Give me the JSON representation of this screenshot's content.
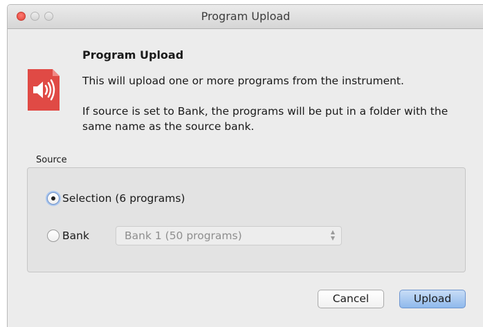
{
  "window": {
    "title": "Program Upload"
  },
  "dialog": {
    "heading": "Program Upload",
    "description": "This will upload one or more programs from the instrument.",
    "note": "If source is set to Bank, the programs will be put in a folder with the same name as the source bank.",
    "icon": "speaker-document-icon",
    "icon_color": "#e04a45"
  },
  "source": {
    "label": "Source",
    "options": [
      {
        "label": "Selection (6 programs)",
        "selected": true
      },
      {
        "label": "Bank",
        "selected": false
      }
    ],
    "bank_select": {
      "value": "Bank 1 (50 programs)",
      "enabled": false
    }
  },
  "buttons": {
    "cancel": "Cancel",
    "upload": "Upload"
  }
}
